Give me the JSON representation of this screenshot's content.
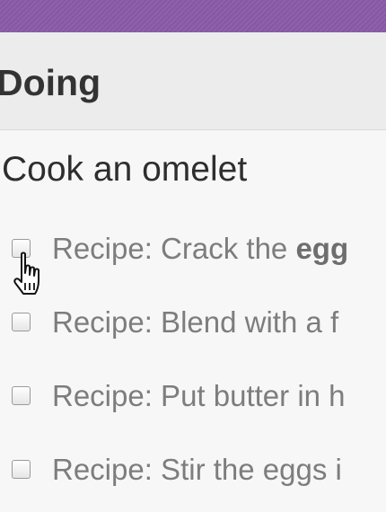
{
  "column": {
    "title": "Doing"
  },
  "card": {
    "title": "Cook an omelet",
    "tasks": [
      {
        "prefix": "Recipe: Crack the ",
        "bold": "egg"
      },
      {
        "prefix": "Recipe: Blend with a f",
        "bold": ""
      },
      {
        "prefix": "Recipe: Put butter in h",
        "bold": ""
      },
      {
        "prefix": "Recipe: Stir the eggs i",
        "bold": ""
      }
    ]
  },
  "colors": {
    "top_bar": "#8a5aa8",
    "header_bg": "#ececec",
    "card_bg": "#f7f7f7",
    "task_text": "#7d7d7d"
  },
  "icons": {
    "cursor": "hand-pointer-icon",
    "checkbox": "checkbox-icon"
  }
}
